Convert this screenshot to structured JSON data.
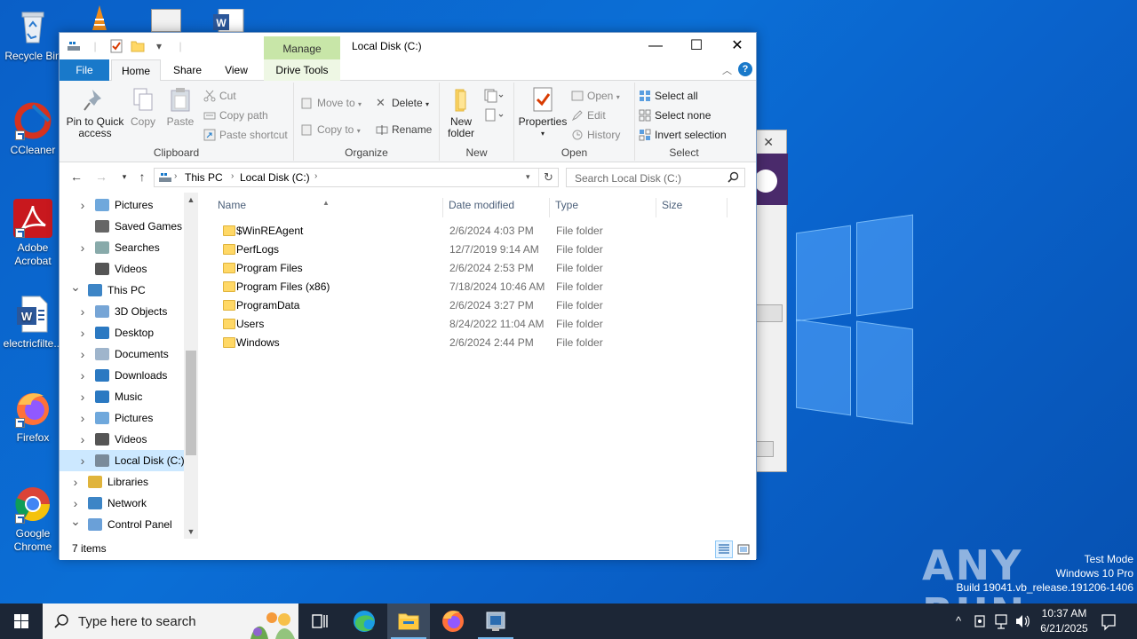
{
  "desktop": {
    "icons": [
      {
        "label": "Recycle Bin",
        "icon": "recycle-bin-icon"
      },
      {
        "label": "CCleaner",
        "icon": "ccleaner-icon"
      },
      {
        "label": "Adobe Acrobat",
        "icon": "adobe-acrobat-icon"
      },
      {
        "label": "electricfilte...",
        "icon": "word-document-icon"
      },
      {
        "label": "Firefox",
        "icon": "firefox-icon"
      },
      {
        "label": "Google Chrome",
        "icon": "chrome-icon"
      }
    ],
    "watermark": {
      "line1": "Test Mode",
      "line2": "Windows 10 Pro",
      "line3": "Build 19041.vb_release.191206-1406"
    },
    "brand": "ANY RUN"
  },
  "explorer": {
    "title": "Local Disk (C:)",
    "context_tab": "Manage",
    "tabs": {
      "file": "File",
      "home": "Home",
      "share": "Share",
      "view": "View",
      "drive_tools": "Drive Tools"
    },
    "ribbon": {
      "clipboard": {
        "label": "Clipboard",
        "pin_line1": "Pin to Quick",
        "pin_line2": "access",
        "copy": "Copy",
        "paste": "Paste",
        "cut": "Cut",
        "copy_path": "Copy path",
        "paste_shortcut": "Paste shortcut"
      },
      "organize": {
        "label": "Organize",
        "move_to": "Move to",
        "copy_to": "Copy to",
        "delete": "Delete",
        "rename": "Rename"
      },
      "new": {
        "label": "New",
        "new_folder_line1": "New",
        "new_folder_line2": "folder"
      },
      "open": {
        "label": "Open",
        "properties": "Properties",
        "open": "Open",
        "edit": "Edit",
        "history": "History"
      },
      "select": {
        "label": "Select",
        "select_all": "Select all",
        "select_none": "Select none",
        "invert": "Invert selection"
      }
    },
    "address": {
      "crumbs": [
        "This PC",
        "Local Disk (C:)"
      ]
    },
    "search_placeholder": "Search Local Disk (C:)",
    "nav": [
      {
        "label": "Pictures",
        "icon": "pictures-icon",
        "indent": 1,
        "expander": "collapsed"
      },
      {
        "label": "Saved Games",
        "icon": "saved-games-icon",
        "indent": 1,
        "expander": "none"
      },
      {
        "label": "Searches",
        "icon": "searches-icon",
        "indent": 1,
        "expander": "collapsed"
      },
      {
        "label": "Videos",
        "icon": "videos-icon",
        "indent": 1,
        "expander": "none"
      },
      {
        "label": "This PC",
        "icon": "this-pc-icon",
        "indent": 0,
        "expander": "expanded"
      },
      {
        "label": "3D Objects",
        "icon": "3d-objects-icon",
        "indent": 1,
        "expander": "collapsed"
      },
      {
        "label": "Desktop",
        "icon": "desktop-folder-icon",
        "indent": 1,
        "expander": "collapsed"
      },
      {
        "label": "Documents",
        "icon": "documents-icon",
        "indent": 1,
        "expander": "collapsed"
      },
      {
        "label": "Downloads",
        "icon": "downloads-icon",
        "indent": 1,
        "expander": "collapsed"
      },
      {
        "label": "Music",
        "icon": "music-icon",
        "indent": 1,
        "expander": "collapsed"
      },
      {
        "label": "Pictures",
        "icon": "pictures-icon",
        "indent": 1,
        "expander": "collapsed"
      },
      {
        "label": "Videos",
        "icon": "videos-icon",
        "indent": 1,
        "expander": "collapsed"
      },
      {
        "label": "Local Disk (C:)",
        "icon": "local-disk-icon",
        "indent": 1,
        "expander": "collapsed",
        "selected": true
      },
      {
        "label": "Libraries",
        "icon": "libraries-icon",
        "indent": 0,
        "expander": "collapsed"
      },
      {
        "label": "Network",
        "icon": "network-icon",
        "indent": 0,
        "expander": "collapsed"
      },
      {
        "label": "Control Panel",
        "icon": "control-panel-icon",
        "indent": 0,
        "expander": "expanded"
      }
    ],
    "columns": {
      "name": "Name",
      "date": "Date modified",
      "type": "Type",
      "size": "Size"
    },
    "files": [
      {
        "name": "$WinREAgent",
        "date": "2/6/2024 4:03 PM",
        "type": "File folder"
      },
      {
        "name": "PerfLogs",
        "date": "12/7/2019 9:14 AM",
        "type": "File folder"
      },
      {
        "name": "Program Files",
        "date": "2/6/2024 2:53 PM",
        "type": "File folder"
      },
      {
        "name": "Program Files (x86)",
        "date": "7/18/2024 10:46 AM",
        "type": "File folder"
      },
      {
        "name": "ProgramData",
        "date": "2/6/2024 3:27 PM",
        "type": "File folder"
      },
      {
        "name": "Users",
        "date": "8/24/2022 11:04 AM",
        "type": "File folder"
      },
      {
        "name": "Windows",
        "date": "2/6/2024 2:44 PM",
        "type": "File folder"
      }
    ],
    "status": "7 items"
  },
  "taskbar": {
    "search_placeholder": "Type here to search",
    "time": "10:37 AM",
    "date": "6/21/2025"
  },
  "colors": {
    "accent": "#1979ca",
    "selection": "#cce8ff",
    "folder": "#ffd866",
    "manage_tab": "#c8e6a8",
    "taskbar": "#1c2636"
  }
}
